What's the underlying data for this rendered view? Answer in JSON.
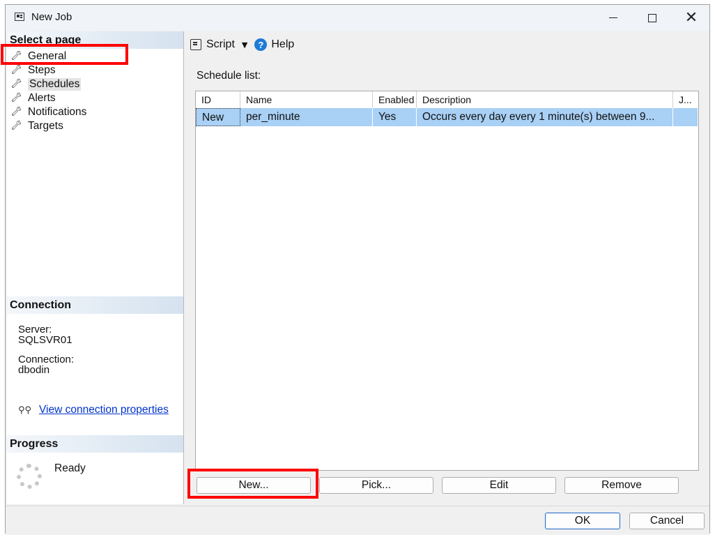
{
  "window": {
    "title": "New Job"
  },
  "sidebar": {
    "header": "Select a page",
    "items": [
      {
        "label": "General",
        "icon": "wrench-icon"
      },
      {
        "label": "Steps",
        "icon": "wrench-icon"
      },
      {
        "label": "Schedules",
        "icon": "wrench-icon",
        "selected": true
      },
      {
        "label": "Alerts",
        "icon": "wrench-icon"
      },
      {
        "label": "Notifications",
        "icon": "wrench-icon"
      },
      {
        "label": "Targets",
        "icon": "wrench-icon"
      }
    ]
  },
  "connection": {
    "header": "Connection",
    "server_label": "Server:",
    "server_value": "SQLSVR01",
    "connection_label": "Connection:",
    "connection_value": "dbodin",
    "link": "View connection properties"
  },
  "progress": {
    "header": "Progress",
    "status": "Ready"
  },
  "toolbar": {
    "script": "Script",
    "help": "Help"
  },
  "schedule": {
    "label": "Schedule list:",
    "columns": [
      "ID",
      "Name",
      "Enabled",
      "Description",
      "J..."
    ],
    "rows": [
      {
        "id": "New",
        "name": "per_minute",
        "enabled": "Yes",
        "description": "Occurs every day every 1 minute(s) between 9...",
        "j": ""
      }
    ]
  },
  "buttons": {
    "new": "New...",
    "pick": "Pick...",
    "edit": "Edit",
    "remove": "Remove",
    "ok": "OK",
    "cancel": "Cancel"
  },
  "colors": {
    "highlight_box": "#ff0000",
    "selected_row": "#a9d0f5",
    "link": "#0033cc"
  }
}
